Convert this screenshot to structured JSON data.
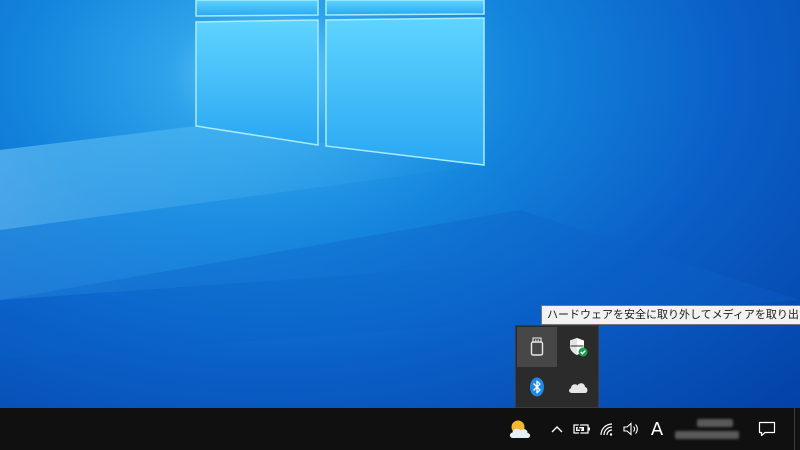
{
  "tooltip": {
    "text": "ハードウェアを安全に取り外してメディアを取り出す"
  },
  "tray_popup": {
    "items": [
      {
        "icon": "usb-drive-eject-icon",
        "hovered": true
      },
      {
        "icon": "windows-security-icon"
      },
      {
        "icon": "bluetooth-icon"
      },
      {
        "icon": "onedrive-cloud-icon"
      }
    ]
  },
  "taskbar": {
    "weather_icon": "weather-partly-cloudy-icon",
    "tray_icons": [
      "chevron-up-icon",
      "battery-icon",
      "wifi-icon",
      "volume-icon"
    ],
    "ime_indicator": "A",
    "clock_obscured": true,
    "notification_icon": "action-center-icon"
  },
  "colors": {
    "taskbar_bg": "#101010",
    "popup_bg": "#2b2b2b",
    "tooltip_bg": "#f2f2f2",
    "desktop_primary": "#1384dc",
    "bluetooth_blue": "#1e88e5",
    "shield_check_green": "#16a34a"
  }
}
